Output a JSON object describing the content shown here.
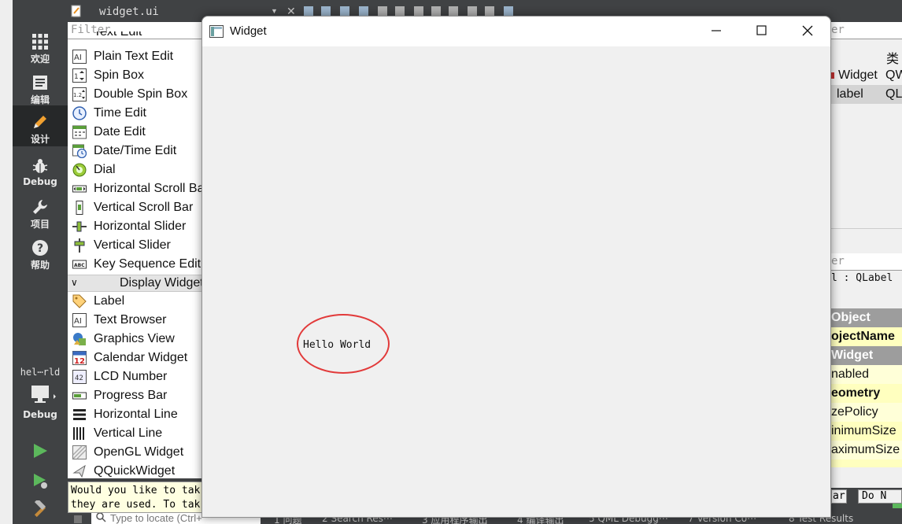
{
  "modes": [
    {
      "label": "欢迎",
      "icon": "grid-icon"
    },
    {
      "label": "编辑",
      "icon": "edit-doc-icon"
    },
    {
      "label": "设计",
      "icon": "pencil-icon"
    },
    {
      "label": "Debug",
      "icon": "bug-icon"
    },
    {
      "label": "项目",
      "icon": "wrench-icon"
    },
    {
      "label": "帮助",
      "icon": "help-icon"
    }
  ],
  "project": {
    "name": "hel⋯rld",
    "kit": "Debug"
  },
  "editor_tab": {
    "file_name": "widget.ui",
    "close_glyph": "✕",
    "dropdown_glyph": "▼"
  },
  "widget_box": {
    "filter_placeholder": "Filter",
    "top_cut_item": "Text Edit",
    "input_items": [
      "Plain Text Edit",
      "Spin Box",
      "Double Spin Box",
      "Time Edit",
      "Date Edit",
      "Date/Time Edit",
      "Dial",
      "Horizontal Scroll Bar",
      "Vertical Scroll Bar",
      "Horizontal Slider",
      "Vertical Slider",
      "Key Sequence Edit"
    ],
    "display_category": "Display Widgets",
    "display_items": [
      "Label",
      "Text Browser",
      "Graphics View",
      "Calendar Widget",
      "LCD Number",
      "Progress Bar",
      "Horizontal Line",
      "Vertical Line",
      "OpenGL Widget",
      "QQuickWidget"
    ]
  },
  "message": {
    "line1": "Would you like to tak",
    "line2": "they are used. To tak"
  },
  "bottom_bar": {
    "locate_placeholder": "Type to locate (Ctrl+",
    "output_tabs": [
      "1 问题",
      "2 Search Res⋯",
      "3 应用程序输出",
      "4 编译输出",
      "5 QML Debugg⋯",
      "7 Version Co⋯",
      "8 Test Results"
    ]
  },
  "right_pane": {
    "filter_top": "er",
    "col_header": "类",
    "obj_row1_name": "Widget",
    "obj_row1_class": "QW",
    "obj_row2_name": "label",
    "obj_row2_class": "QL",
    "filter_mid": "er",
    "selected_object": "l : QLabel",
    "props": [
      {
        "text": "Object",
        "kind": "hdr"
      },
      {
        "text": "ojectName",
        "kind": "yel-bold"
      },
      {
        "text": "Widget",
        "kind": "hdr"
      },
      {
        "text": "nabled",
        "kind": "yel2"
      },
      {
        "text": "eometry",
        "kind": "yel-bold"
      },
      {
        "text": "zePolicy",
        "kind": "yel2"
      },
      {
        "text": "inimumSize",
        "kind": "yel"
      },
      {
        "text": "aximumSize",
        "kind": "yel2"
      }
    ],
    "btn1": "ar",
    "btn2": "Do N"
  },
  "preview_window": {
    "title": "Widget",
    "label_text": "Hello World",
    "annotation_color": "#e23a3a"
  },
  "colors": {
    "accent_red": "#e23a3a",
    "sidebar": "#404244",
    "tooltip_yellow": "#ffffe1"
  }
}
